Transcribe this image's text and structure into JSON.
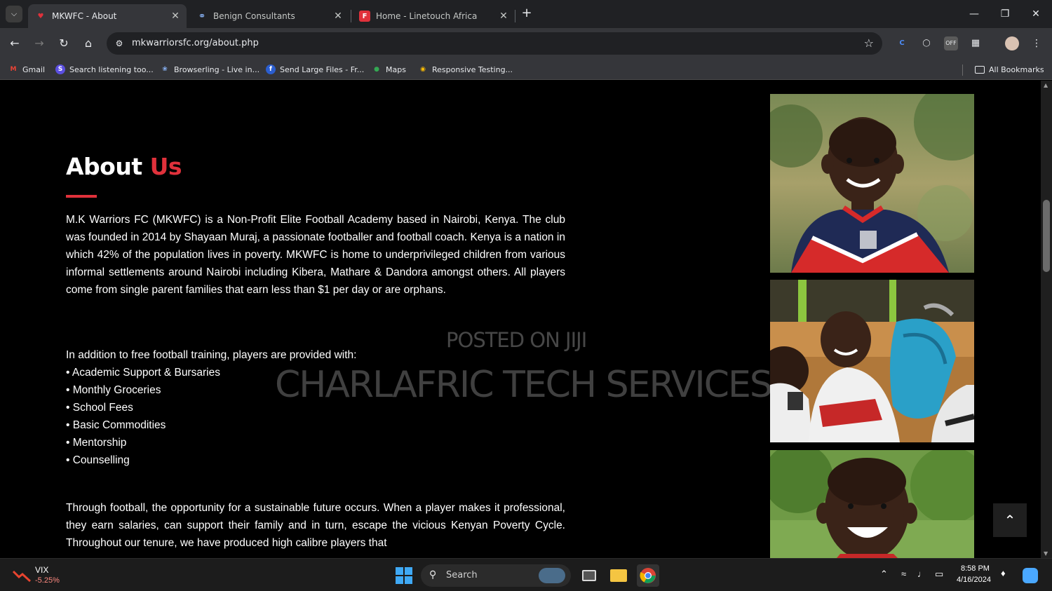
{
  "browser": {
    "tabs": [
      {
        "label": "MKWFC - About",
        "active": true,
        "favicon_color": "#e0313b"
      },
      {
        "label": "Benign Consultants",
        "active": false,
        "favicon_color": "#8ab4f8"
      },
      {
        "label": "Home - Linetouch Africa",
        "active": false,
        "favicon_color": "#e0313b"
      }
    ],
    "url": "mkwarriorsfc.org/about.php",
    "bookmarks": [
      {
        "label": "Gmail",
        "icon": "gmail-icon"
      },
      {
        "label": "Search listening too...",
        "icon": "search-listening-icon"
      },
      {
        "label": "Browserling - Live in...",
        "icon": "browserling-icon"
      },
      {
        "label": "Send Large Files - Fr...",
        "icon": "send-files-icon"
      },
      {
        "label": "Maps",
        "icon": "maps-icon"
      },
      {
        "label": "Responsive Testing...",
        "icon": "chrome-icon"
      }
    ],
    "all_bookmarks": "All Bookmarks"
  },
  "page": {
    "title_white": "About",
    "title_accent": "Us",
    "accent_color": "#e0313b",
    "intro": "M.K Warriors FC (MKWFC) is a Non-Profit Elite Football Academy based in Nairobi, Kenya. The club was founded in 2014 by Shayaan Muraj, a passionate footballer and football coach. Kenya is a nation in which 42% of the population lives in poverty. MKWFC is home to underprivileged children from various informal settlements around Nairobi including Kibera, Mathare & Dandora amongst others. All players come from single parent families that earn less than $1 per day or are orphans.",
    "provided_heading": "In addition to free football training, players are provided with:",
    "provided_items": [
      "• Academic Support & Bursaries",
      "• Monthly Groceries",
      "• School Fees",
      "• Basic Commodities",
      "• Mentorship",
      "• Counselling"
    ],
    "outro": "Through football, the opportunity for a sustainable future occurs. When a player makes it professional, they earn salaries, can support their family and in turn, escape the vicious Kenyan Poverty Cycle. Throughout our tenure, we have produced high calibre players that",
    "watermark_top": "POSTED ON JIJI",
    "watermark_main": "CHARLAFRIC TECH SERVICES"
  },
  "taskbar": {
    "stock_name": "VIX",
    "stock_change": "-5.25%",
    "search_label": "Search",
    "time": "8:58 PM",
    "date": "4/16/2024"
  }
}
